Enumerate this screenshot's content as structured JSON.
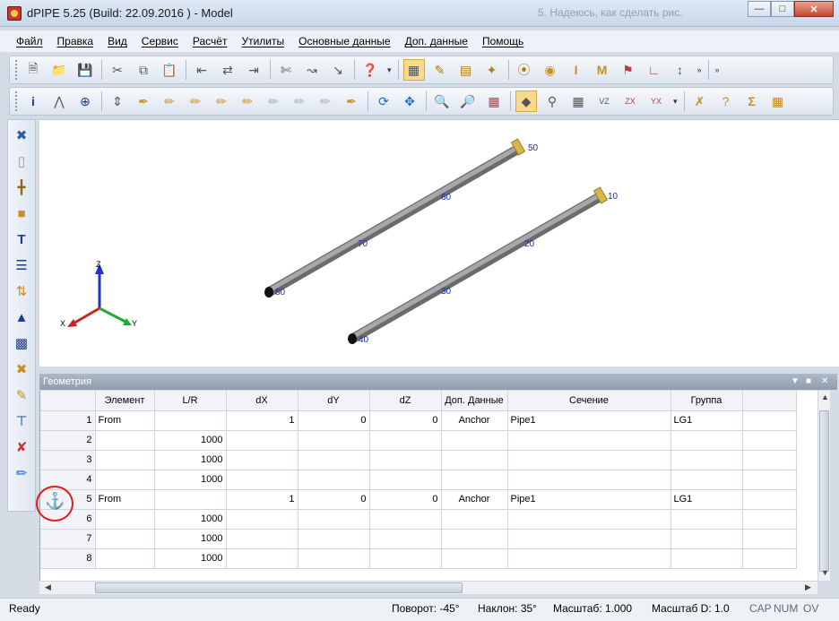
{
  "window": {
    "title": "dPIPE 5.25 (Build: 22.09.2016 ) - Model",
    "background_title": "5.   Надеюсь, как сделать рис."
  },
  "menu": [
    "Файл",
    "Правка",
    "Вид",
    "Сервис",
    "Расчёт",
    "Утилиты",
    "Основные данные",
    "Доп. данные",
    "Помощь"
  ],
  "toolbar1": [
    "new-icon",
    "open-icon",
    "save-icon",
    "cut-icon",
    "copy-icon",
    "paste-icon",
    "indent-left-icon",
    "indent-icon",
    "indent-right-icon",
    "scissors-icon",
    "chart-icon",
    "measure-icon",
    "help-icon",
    "grid-view-icon",
    "edit-icon",
    "notes-icon",
    "wand-icon",
    "valve-icon",
    "ring-icon",
    "beam-i-icon",
    "beam-m-icon",
    "flag-icon",
    "curve-icon",
    "graph-icon"
  ],
  "toolbar2": [
    "info-icon",
    "compass-icon",
    "target-icon",
    "align-icon",
    "pen-icon",
    "pencil-icon",
    "pencil2-icon",
    "brush-icon",
    "pen3-icon",
    "pen4-icon",
    "pen5-icon",
    "pen6-icon",
    "rotate-icon",
    "move-icon",
    "zoom-in-icon",
    "zoom-icon",
    "zoom-fit-icon",
    "iso-view-icon",
    "tool-icon",
    "view-icon",
    "sketch-icon",
    "chart-vz-icon",
    "chart-zx-icon",
    "chart-yx-icon",
    "cross-icon",
    "query-icon",
    "sum-icon",
    "table-icon"
  ],
  "lefttoolbar": [
    "cross-tool-icon",
    "cylinder-icon",
    "support-icon",
    "pipe-icon",
    "tee-icon",
    "flange-icon",
    "reducer-icon",
    "valve-tool-icon",
    "pump-icon",
    "x-tool-icon",
    "beam-tool-icon",
    "hanger-icon",
    "tool2-icon",
    "spring-icon"
  ],
  "viewport": {
    "axes": {
      "x": "X",
      "y": "Y",
      "z": "Z"
    },
    "nodes": [
      "50",
      "60",
      "70",
      "80",
      "10",
      "20",
      "30",
      "40"
    ]
  },
  "panel": {
    "title": "Геометрия",
    "columns": [
      "",
      "Элемент",
      "L/R",
      "dX",
      "dY",
      "dZ",
      "Доп. Данные",
      "Сечение",
      "Группа",
      ""
    ],
    "rows": [
      {
        "n": "1",
        "element": "From",
        "lr": "",
        "dx": "1",
        "dy": "0",
        "dz": "0",
        "extra": "Anchor",
        "section": "Pipe1",
        "group": "LG1"
      },
      {
        "n": "2",
        "element": "",
        "lr": "1000",
        "dx": "",
        "dy": "",
        "dz": "",
        "extra": "",
        "section": "",
        "group": ""
      },
      {
        "n": "3",
        "element": "",
        "lr": "1000",
        "dx": "",
        "dy": "",
        "dz": "",
        "extra": "",
        "section": "",
        "group": ""
      },
      {
        "n": "4",
        "element": "",
        "lr": "1000",
        "dx": "",
        "dy": "",
        "dz": "",
        "extra": "",
        "section": "",
        "group": ""
      },
      {
        "n": "5",
        "element": "From",
        "lr": "",
        "dx": "1",
        "dy": "0",
        "dz": "0",
        "extra": "Anchor",
        "section": "Pipe1",
        "group": "LG1"
      },
      {
        "n": "6",
        "element": "",
        "lr": "1000",
        "dx": "",
        "dy": "",
        "dz": "",
        "extra": "",
        "section": "",
        "group": ""
      },
      {
        "n": "7",
        "element": "",
        "lr": "1000",
        "dx": "",
        "dy": "",
        "dz": "",
        "extra": "",
        "section": "",
        "group": ""
      },
      {
        "n": "8",
        "element": "",
        "lr": "1000",
        "dx": "",
        "dy": "",
        "dz": "",
        "extra": "",
        "section": "",
        "group": ""
      }
    ]
  },
  "status": {
    "ready": "Ready",
    "rotation": "Поворот: -45°",
    "tilt": "Наклон: 35°",
    "scale": "Масштаб: 1.000",
    "scale_d": "Масштаб D: 1.0",
    "cap": "CAP",
    "num": "NUM",
    "ov": "OV"
  },
  "colors": {
    "anchor": "#d9b44a",
    "pipe": "#8e8e8e",
    "node_label": "#1b2fb0",
    "marker": "#e21a1a"
  }
}
